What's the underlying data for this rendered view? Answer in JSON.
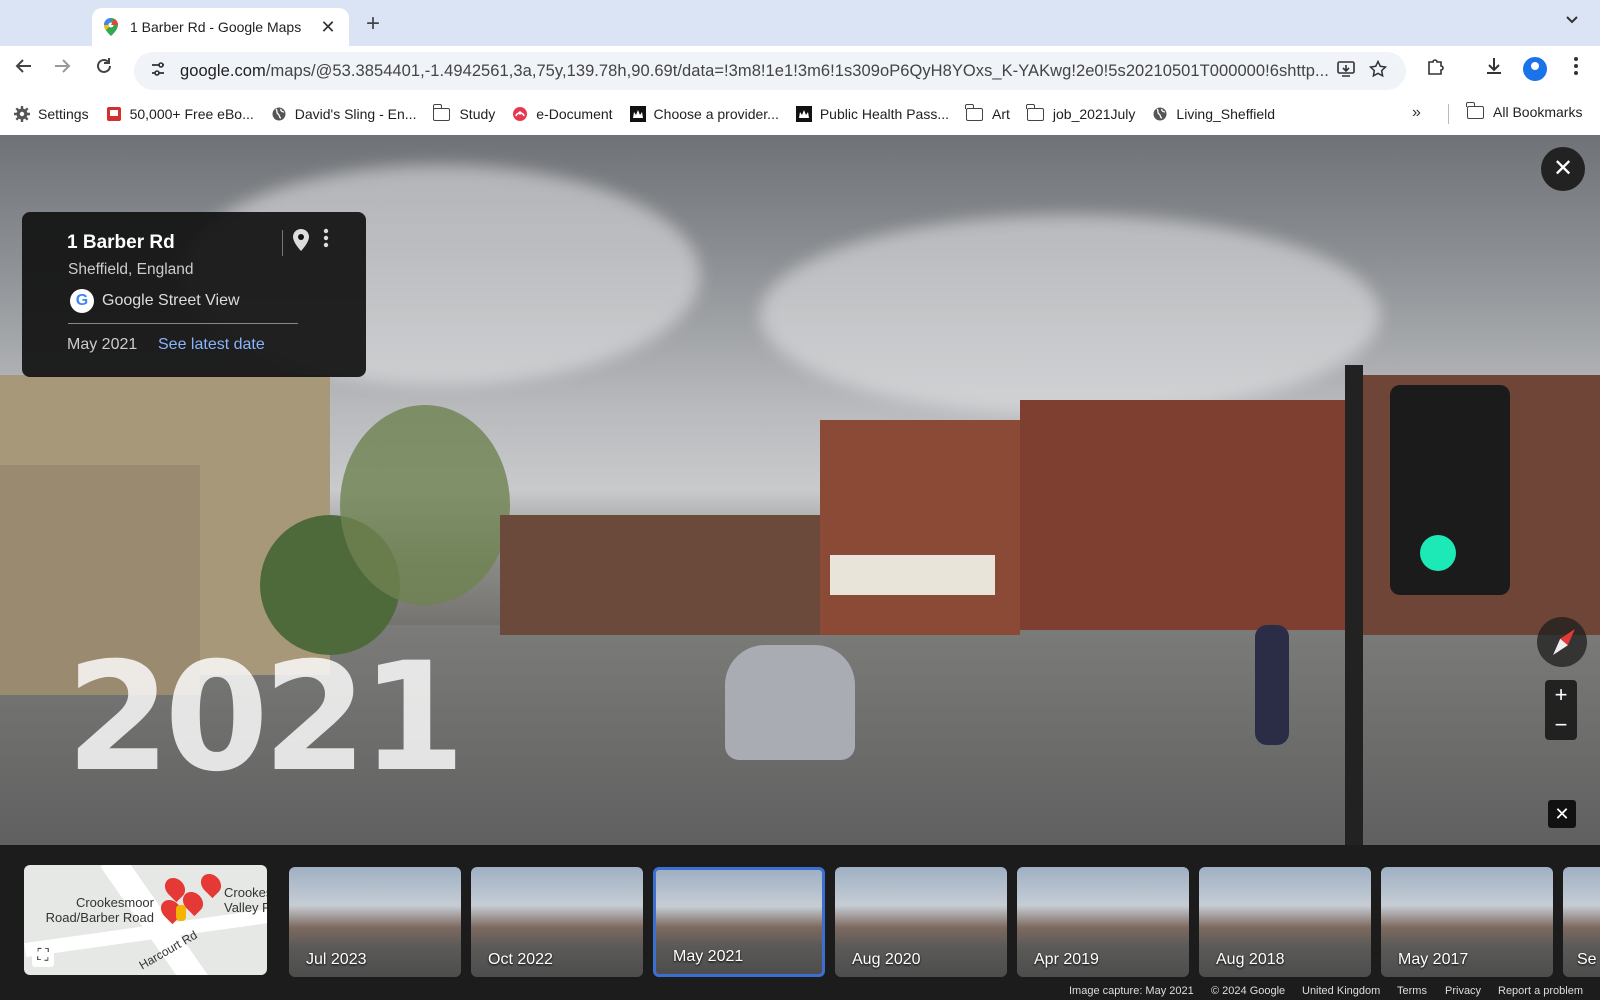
{
  "browser": {
    "tab": {
      "title": "1 Barber Rd - Google Maps",
      "close": "✕"
    },
    "new_tab": "+",
    "url": {
      "host": "google.com",
      "rest": "/maps/@53.3854401,-1.4942561,3a,75y,139.78h,90.69t/data=!3m8!1e1!3m6!1s309oP6QyH8YOxs_K-YAKwg!2e0!5s20210501T000000!6shttp..."
    },
    "bookmarks": [
      {
        "label": "Settings",
        "icon": "gear-icon"
      },
      {
        "label": "50,000+ Free eBo...",
        "icon": "book-icon"
      },
      {
        "label": "David's Sling - En...",
        "icon": "globe-icon"
      },
      {
        "label": "Study",
        "icon": "folder-icon"
      },
      {
        "label": "e-Document",
        "icon": "document-icon"
      },
      {
        "label": "Choose a provider...",
        "icon": "crown-icon"
      },
      {
        "label": "Public Health Pass...",
        "icon": "crown-icon"
      },
      {
        "label": "Art",
        "icon": "folder-icon"
      },
      {
        "label": "job_2021July",
        "icon": "folder-icon"
      },
      {
        "label": "Living_Sheffield",
        "icon": "globe-icon"
      }
    ],
    "more_bookmarks": "»",
    "all_bookmarks": "All Bookmarks"
  },
  "streetview": {
    "year_overlay": "2021",
    "card": {
      "address": "1 Barber Rd",
      "city": "Sheffield, England",
      "source": "Google Street View",
      "date": "May 2021",
      "see_latest": "See latest date"
    }
  },
  "timeline": {
    "map_labels": {
      "crookesmoor": "Crookesmoor\nRoad/Barber Road",
      "crookes_valley": "Crookes\nValley Roa",
      "harcourt": "Harcourt Rd"
    },
    "thumbs": [
      {
        "label": "Jul 2023",
        "selected": false
      },
      {
        "label": "Oct 2022",
        "selected": false
      },
      {
        "label": "May 2021",
        "selected": true
      },
      {
        "label": "Aug 2020",
        "selected": false
      },
      {
        "label": "Apr 2019",
        "selected": false
      },
      {
        "label": "Aug 2018",
        "selected": false
      },
      {
        "label": "May 2017",
        "selected": false
      },
      {
        "label": "Se",
        "selected": false
      }
    ]
  },
  "footer": {
    "capture": "Image capture: May 2021",
    "copyright": "© 2024 Google",
    "region": "United Kingdom",
    "terms": "Terms",
    "privacy": "Privacy",
    "report": "Report a problem"
  },
  "colors": {
    "accent": "#3d6fd1",
    "link": "#8ab4f8",
    "tabstrip": "#dbe4f5"
  }
}
